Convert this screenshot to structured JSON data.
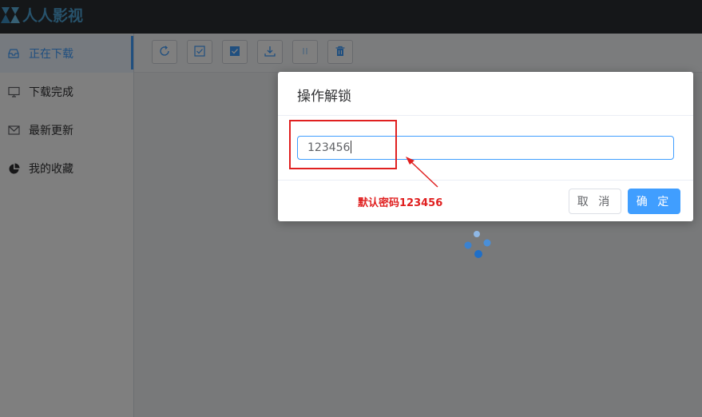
{
  "app": {
    "logo_text": "人人影视",
    "logo_icon": "rr-logo-icon"
  },
  "sidebar": {
    "items": [
      {
        "label": "正在下载",
        "icon": "inbox-icon",
        "active": true
      },
      {
        "label": "下载完成",
        "icon": "monitor-icon",
        "active": false
      },
      {
        "label": "最新更新",
        "icon": "mail-icon",
        "active": false
      },
      {
        "label": "我的收藏",
        "icon": "pie-chart-icon",
        "active": false
      }
    ]
  },
  "toolbar": {
    "buttons": [
      {
        "icon": "refresh-icon"
      },
      {
        "icon": "checkbox-icon"
      },
      {
        "icon": "checkbox-checked-icon"
      },
      {
        "icon": "download-icon"
      },
      {
        "icon": "pause-icon"
      },
      {
        "icon": "delete-icon"
      }
    ]
  },
  "dialog": {
    "title": "操作解锁",
    "input_value": "123456",
    "cancel_label": "取 消",
    "confirm_label": "确 定"
  },
  "annotation": {
    "text": "默认密码123456"
  },
  "colors": {
    "accent": "#409eff",
    "annotation": "#e02020",
    "topbar": "#2a2e33"
  }
}
